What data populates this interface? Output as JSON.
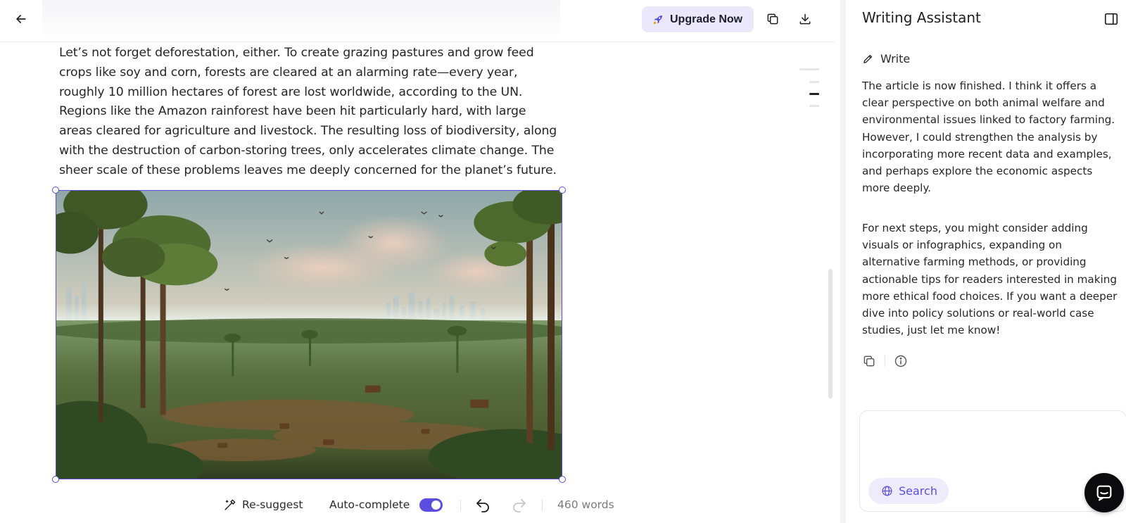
{
  "toolbar": {
    "back_icon": "arrow-left-icon",
    "upgrade_label": "Upgrade Now",
    "upgrade_icon": "rocket-icon",
    "copy_icon": "copy-icon",
    "download_icon": "download-icon"
  },
  "article": {
    "paragraph": "Let’s not forget deforestation, either. To create grazing pastures and grow feed crops like soy and corn, forests are cleared at an alarming rate—every year, roughly 10 million hectares of forest are lost worldwide, according to the UN. Regions like the Amazon rainforest have been hit particularly hard, with large areas cleared for agriculture and livestock. The resulting loss of biodiversity, along with the destruction of carbon-storing trees, only accelerates climate change. The sheer scale of these problems leaves me deeply concerned for the planet’s future."
  },
  "bottombar": {
    "resuggest_label": "Re-suggest",
    "autocomplete_label": "Auto-complete",
    "autocomplete_on": true,
    "word_count": "460 words"
  },
  "assistant": {
    "title": "Writing Assistant",
    "mode_label": "Write",
    "paragraph_1": "The article is now finished. I think it offers a clear perspective on both animal welfare and environmental issues linked to factory farming. However, I could strengthen the analysis by incorporating more recent data and examples, and perhaps explore the economic aspects more deeply.",
    "paragraph_2": "For next steps, you might consider adding visuals or infographics, expanding on alternative farming methods, or providing actionable tips for readers interested in making more ethical food choices. If you want a deeper dive into policy solutions or real-world case studies, just let me know!",
    "composer_value": "",
    "search_label": "Search"
  },
  "colors": {
    "accent": "#5b4de0",
    "upgrade_bg": "#ebe8fc",
    "text": "#25252b"
  }
}
